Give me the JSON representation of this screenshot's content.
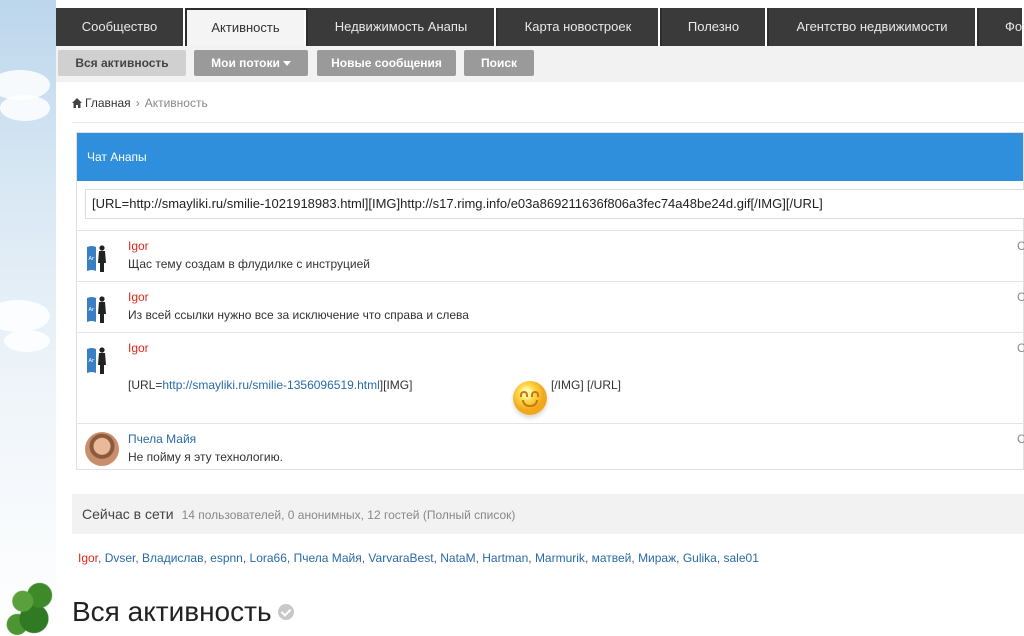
{
  "topnav": {
    "tabs": [
      {
        "label": "Сообщество"
      },
      {
        "label": "Активность"
      },
      {
        "label": "Недвижимость Анапы"
      },
      {
        "label": "Карта новостроек"
      },
      {
        "label": "Полезно"
      },
      {
        "label": "Агентство недвижимости"
      },
      {
        "label": "Фото"
      }
    ]
  },
  "subnav": {
    "all_activity": "Вся активность",
    "my_streams": "Мои потоки",
    "new_messages": "Новые сообщения",
    "search": "Поиск"
  },
  "breadcrumb": {
    "home": "Главная",
    "current": "Активность"
  },
  "chat": {
    "title": "Чат Анапы",
    "input_value": "[URL=http://smayliki.ru/smilie-1021918983.html][IMG]http://s17.rimg.info/e03a869211636f806a3fec74a48be24d.gif[/IMG][/URL]",
    "messages": [
      {
        "user": "Igor",
        "text": "Щас тему создам в флудилке с инструцией",
        "time": "С"
      },
      {
        "user": "Igor",
        "text": "Из всей ссылки нужно все за исключение что справа и слева",
        "time": "С"
      },
      {
        "user": "Igor",
        "text_prefix": "[URL=",
        "link": "http://smayliki.ru/smilie-1356096519.html",
        "text_mid": "][IMG]",
        "text_suffix": "[/IMG] [/URL]",
        "time": "С"
      },
      {
        "user": "Пчела Майя",
        "text": "Не пойму я эту технологию.",
        "time": "С"
      }
    ]
  },
  "online": {
    "title": "Сейчас в сети",
    "stats": "14 пользователей, 0 анонимных, 12 гостей (Полный список)",
    "users": [
      "Igor",
      "Dvser",
      "Владислав",
      "espnn",
      "Lora66",
      "Пчела Майя",
      "VarvaraBest",
      "NataM",
      "Hartman",
      "Marmurik",
      "матвей",
      "Мираж",
      "Gulika",
      "sale01"
    ]
  },
  "page_heading": "Вся активность",
  "colors": {
    "chat_header": "#2f8fdc",
    "username_red": "#e5271b",
    "link_blue": "#2a6aa8"
  }
}
